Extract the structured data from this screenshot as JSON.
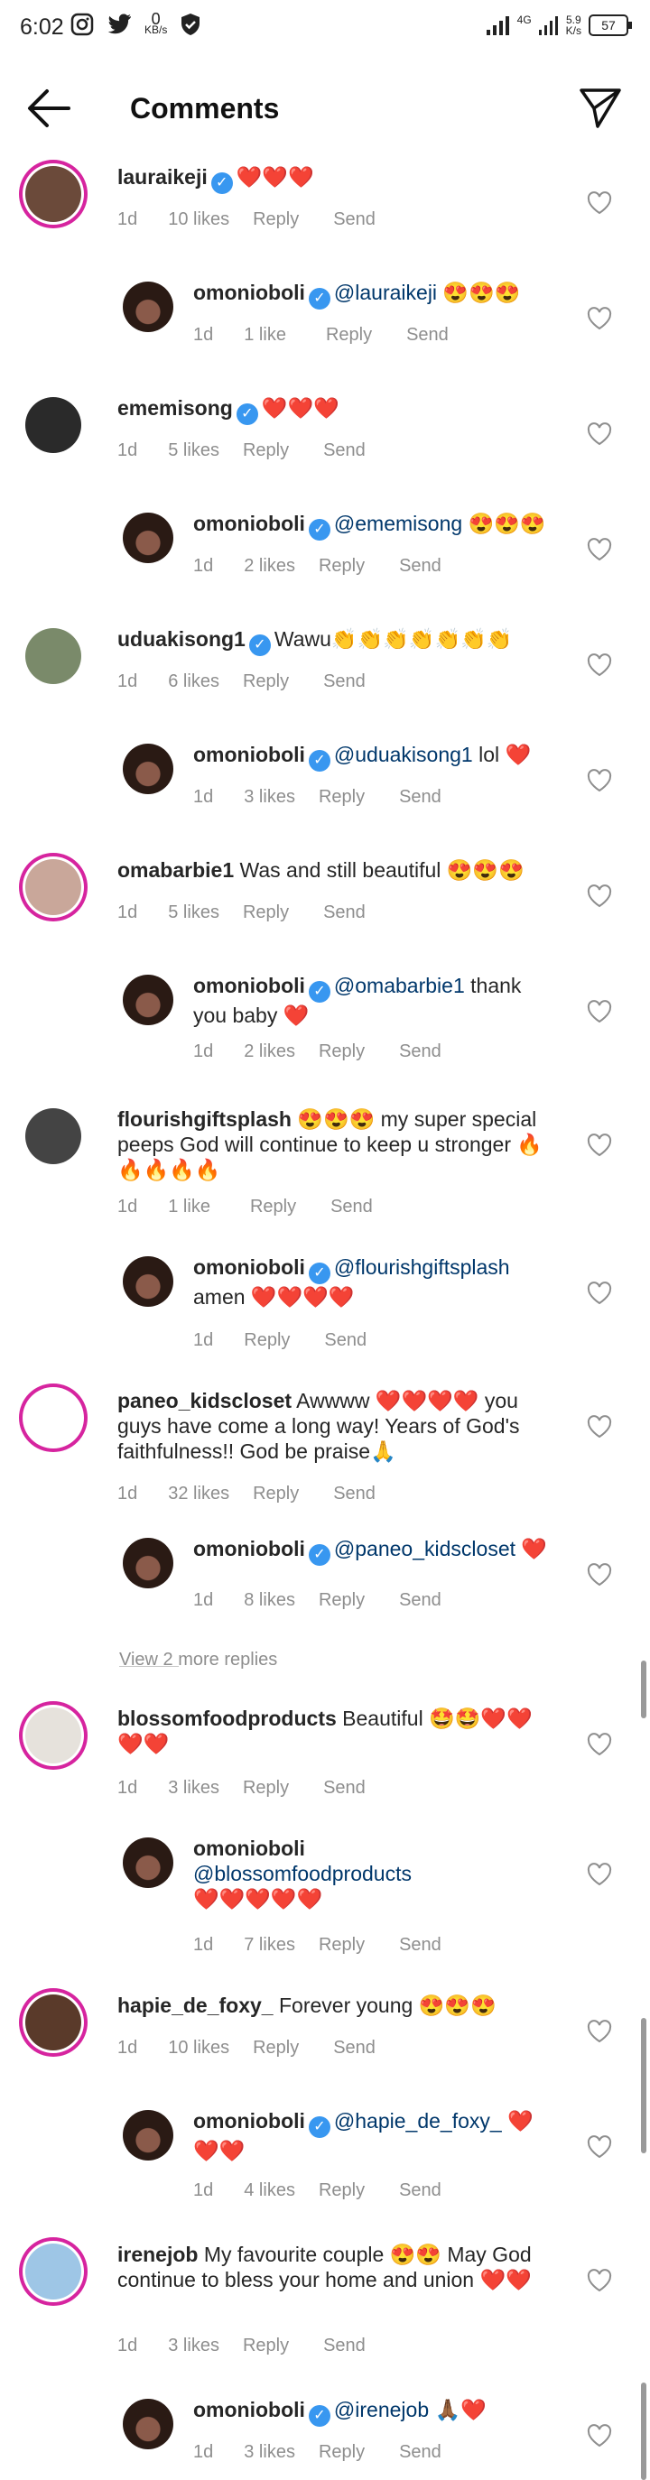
{
  "status": {
    "time": "6:02",
    "net_speed": "0",
    "net_unit": "KB/s",
    "signal_label": "4G",
    "speed2": "5.9",
    "speed2_unit": "K/s",
    "battery": "57"
  },
  "header": {
    "title": "Comments"
  },
  "view_more": "View 2 more replies",
  "comments": [
    {
      "user": "lauraikeji",
      "verified": true,
      "text": "❤️❤️❤️",
      "mention": "",
      "time": "1d",
      "likes": "10 likes",
      "reply": "Reply",
      "send": "Send",
      "reply_to": false
    },
    {
      "user": "omonioboli",
      "verified": true,
      "text": " 😍😍😍",
      "mention": "@lauraikeji",
      "time": "1d",
      "likes": "1 like",
      "reply": "Reply",
      "send": "Send",
      "reply_to": true
    },
    {
      "user": "ememisong",
      "verified": true,
      "text": "❤️❤️❤️",
      "mention": "",
      "time": "1d",
      "likes": "5 likes",
      "reply": "Reply",
      "send": "Send",
      "reply_to": false
    },
    {
      "user": "omonioboli",
      "verified": true,
      "text": " 😍😍😍",
      "mention": "@ememisong",
      "time": "1d",
      "likes": "2 likes",
      "reply": "Reply",
      "send": "Send",
      "reply_to": true
    },
    {
      "user": "uduakisong1",
      "verified": true,
      "text": "Wawu👏👏👏👏👏👏👏",
      "mention": "",
      "time": "1d",
      "likes": "6 likes",
      "reply": "Reply",
      "send": "Send",
      "reply_to": false
    },
    {
      "user": "omonioboli",
      "verified": true,
      "text": " lol ❤️",
      "mention": "@uduakisong1",
      "time": "1d",
      "likes": "3 likes",
      "reply": "Reply",
      "send": "Send",
      "reply_to": true
    },
    {
      "user": "omabarbie1",
      "verified": false,
      "text": "Was and still beautiful 😍😍😍",
      "mention": "",
      "time": "1d",
      "likes": "5 likes",
      "reply": "Reply",
      "send": "Send",
      "reply_to": false
    },
    {
      "user": "omonioboli",
      "verified": true,
      "text": " thank you baby ❤️",
      "mention": "@omabarbie1",
      "time": "1d",
      "likes": "2 likes",
      "reply": "Reply",
      "send": "Send",
      "reply_to": true
    },
    {
      "user": "flourishgiftsplash",
      "verified": false,
      "text": "😍😍😍 my super special peeps God will continue to keep  u stronger 🔥🔥🔥🔥🔥",
      "mention": "",
      "time": "1d",
      "likes": "1 like",
      "reply": "Reply",
      "send": "Send",
      "reply_to": false
    },
    {
      "user": "omonioboli",
      "verified": true,
      "text": " amen ❤️❤️❤️❤️",
      "mention": "@flourishgiftsplash",
      "time": "1d",
      "likes": "",
      "reply": "Reply",
      "send": "Send",
      "reply_to": true
    },
    {
      "user": "paneo_kidscloset",
      "verified": false,
      "text": "Awwww ❤️❤️❤️❤️ you guys have come a long way! Years of God's faithfulness!! God be praise🙏",
      "mention": "",
      "time": "1d",
      "likes": "32 likes",
      "reply": "Reply",
      "send": "Send",
      "reply_to": false
    },
    {
      "user": "omonioboli",
      "verified": true,
      "text": " ❤️",
      "mention": "@paneo_kidscloset",
      "time": "1d",
      "likes": "8 likes",
      "reply": "Reply",
      "send": "Send",
      "reply_to": true
    },
    {
      "user": "blossomfoodproducts",
      "verified": false,
      "text": "Beautiful 🤩🤩❤️❤️❤️❤️",
      "mention": "",
      "time": "1d",
      "likes": "3 likes",
      "reply": "Reply",
      "send": "Send",
      "reply_to": false
    },
    {
      "user": "omonioboli",
      "verified": false,
      "text": " ❤️❤️❤️❤️❤️",
      "mention": "@blossomfoodproducts",
      "time": "1d",
      "likes": "7 likes",
      "reply": "Reply",
      "send": "Send",
      "reply_to": true
    },
    {
      "user": "hapie_de_foxy_",
      "verified": false,
      "text": "Forever young 😍😍😍",
      "mention": "",
      "time": "1d",
      "likes": "10 likes",
      "reply": "Reply",
      "send": "Send",
      "reply_to": false
    },
    {
      "user": "omonioboli",
      "verified": true,
      "text": " ❤️❤️❤️",
      "mention": "@hapie_de_foxy_",
      "time": "1d",
      "likes": "4 likes",
      "reply": "Reply",
      "send": "Send",
      "reply_to": true
    },
    {
      "user": "irenejob",
      "verified": false,
      "text": "My favourite couple 😍😍 May God continue to bless your home and union ❤️❤️",
      "mention": "",
      "time": "1d",
      "likes": "3 likes",
      "reply": "Reply",
      "send": "Send",
      "reply_to": false
    },
    {
      "user": "omonioboli",
      "verified": true,
      "text": " 🙏🏾❤️",
      "mention": "@irenejob",
      "time": "1d",
      "likes": "3 likes",
      "reply": "Reply",
      "send": "Send",
      "reply_to": true
    }
  ],
  "colors": {
    "verified": "#3897f0",
    "mention": "#00376b",
    "meta": "#8e8e8e",
    "ring": "#d6249f",
    "heart": "#ed1c24"
  }
}
